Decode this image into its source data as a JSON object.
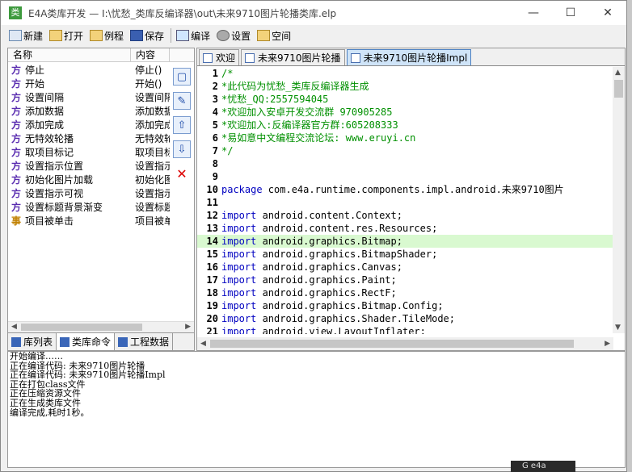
{
  "window": {
    "app_icon_glyph": "类",
    "title": "E4A类库开发 — I:\\忧愁_类库反编译器\\out\\未来9710图片轮播类库.elp",
    "buttons": {
      "minimize": "—",
      "maximize": "☐",
      "close": "✕"
    }
  },
  "toolbar": {
    "items": [
      {
        "label": "新建",
        "icon": "new-file-icon"
      },
      {
        "label": "打开",
        "icon": "folder-open-icon"
      },
      {
        "label": "例程",
        "icon": "folder-icon"
      },
      {
        "label": "保存",
        "icon": "save-icon"
      },
      {
        "label": "编译",
        "icon": "compile-icon"
      },
      {
        "label": "设置",
        "icon": "gear-icon"
      },
      {
        "label": "空间",
        "icon": "folder-icon"
      }
    ]
  },
  "members": {
    "headers": {
      "name": "名称",
      "content": "内容"
    },
    "rows": [
      {
        "badge": "方",
        "type": "method",
        "name": "停止",
        "content": "停止()"
      },
      {
        "badge": "方",
        "type": "method",
        "name": "开始",
        "content": "开始()"
      },
      {
        "badge": "方",
        "type": "method",
        "name": "设置间隔",
        "content": "设置间隔"
      },
      {
        "badge": "方",
        "type": "method",
        "name": "添加数据",
        "content": "添加数据"
      },
      {
        "badge": "方",
        "type": "method",
        "name": "添加完成",
        "content": "添加完成"
      },
      {
        "badge": "方",
        "type": "method",
        "name": "无特效轮播",
        "content": "无特效轮"
      },
      {
        "badge": "方",
        "type": "method",
        "name": "取项目标记",
        "content": "取项目标"
      },
      {
        "badge": "方",
        "type": "method",
        "name": "设置指示位置",
        "content": "设置指示"
      },
      {
        "badge": "方",
        "type": "method",
        "name": "初始化图片加载",
        "content": "初始化图"
      },
      {
        "badge": "方",
        "type": "method",
        "name": "设置指示可视",
        "content": "设置指示"
      },
      {
        "badge": "方",
        "type": "method",
        "name": "设置标题背景渐变",
        "content": "设置标题"
      },
      {
        "badge": "事",
        "type": "event",
        "name": "项目被单击",
        "content": "项目被单"
      }
    ],
    "side_tools": [
      {
        "name": "new-item-icon",
        "glyph": "▢"
      },
      {
        "name": "edit-item-icon",
        "glyph": "✎"
      },
      {
        "name": "move-up-icon",
        "glyph": "⇧"
      },
      {
        "name": "move-down-icon",
        "glyph": "⇩"
      },
      {
        "name": "delete-icon",
        "glyph": "✕"
      }
    ]
  },
  "left_tabs": [
    {
      "label": "库列表"
    },
    {
      "label": "类库命令"
    },
    {
      "label": "工程数据"
    }
  ],
  "editor": {
    "tabs": [
      {
        "label": "欢迎",
        "active": false
      },
      {
        "label": "未来9710图片轮播",
        "active": false
      },
      {
        "label": "未来9710图片轮播Impl",
        "active": true
      }
    ],
    "lines": [
      {
        "n": "1",
        "text": "/*",
        "kind": "comment"
      },
      {
        "n": "2",
        "text": "*此代码为忧愁_类库反编译器生成",
        "kind": "comment"
      },
      {
        "n": "3",
        "text": "*忧愁_QQ:2557594045",
        "kind": "comment"
      },
      {
        "n": "4",
        "text": "*欢迎加入安卓开发交流群 970905285",
        "kind": "comment"
      },
      {
        "n": "5",
        "text": "*欢迎加入:反编译器官方群:605208333",
        "kind": "comment"
      },
      {
        "n": "6",
        "text": "*易如意中文编程交流论坛: www.eruyi.cn",
        "kind": "comment"
      },
      {
        "n": "7",
        "text": "*/",
        "kind": "comment"
      },
      {
        "n": "8",
        "text": "",
        "kind": "code"
      },
      {
        "n": "9",
        "text": "",
        "kind": "code"
      },
      {
        "n": "10",
        "kw": "package",
        "text": " com.e4a.runtime.components.impl.android.未来9710图片",
        "kind": "code"
      },
      {
        "n": "11",
        "text": "",
        "kind": "code"
      },
      {
        "n": "12",
        "kw": "import",
        "text": " android.content.Context;",
        "kind": "code"
      },
      {
        "n": "13",
        "kw": "import",
        "text": " android.content.res.Resources;",
        "kind": "code"
      },
      {
        "n": "14",
        "kw": "import",
        "text": " android.graphics.Bitmap;",
        "kind": "code",
        "highlight": true
      },
      {
        "n": "15",
        "kw": "import",
        "text": " android.graphics.BitmapShader;",
        "kind": "code"
      },
      {
        "n": "16",
        "kw": "import",
        "text": " android.graphics.Canvas;",
        "kind": "code"
      },
      {
        "n": "17",
        "kw": "import",
        "text": " android.graphics.Paint;",
        "kind": "code"
      },
      {
        "n": "18",
        "kw": "import",
        "text": " android.graphics.RectF;",
        "kind": "code"
      },
      {
        "n": "19",
        "kw": "import",
        "text": " android.graphics.Bitmap.Config;",
        "kind": "code"
      },
      {
        "n": "20",
        "kw": "import",
        "text": " android.graphics.Shader.TileMode;",
        "kind": "code"
      },
      {
        "n": "21",
        "kw": "import",
        "text": " android.view.LayoutInflater;",
        "kind": "code"
      }
    ]
  },
  "output": {
    "lines": [
      "开始编译……",
      "正在编译代码: 未来9710图片轮播",
      "正在编译代码: 未来9710图片轮播Impl",
      "正在打包class文件",
      "正在压缩资源文件",
      "正在生成类库文件",
      "编译完成,耗时1秒。"
    ]
  },
  "desktop": {
    "badge_text": "G e4a"
  },
  "colors": {
    "comment": "#009000",
    "keyword": "#0000c0",
    "highlight": "#d9f9d0",
    "active_tab": "#cfe4f8"
  }
}
